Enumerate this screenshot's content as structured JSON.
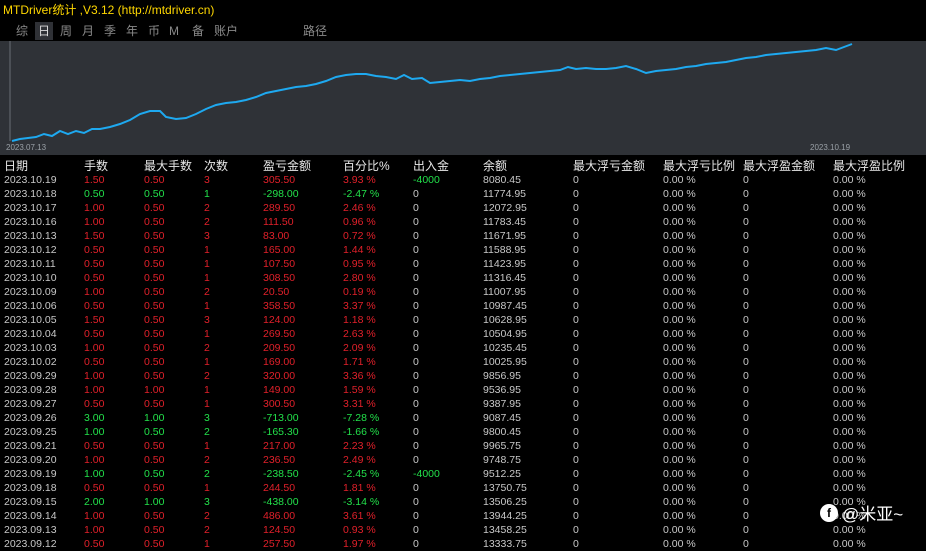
{
  "window": {
    "title": "MTDriver统计 ,V3.12 (http://mtdriver.cn)"
  },
  "tabs": [
    {
      "label": "综",
      "active": false
    },
    {
      "label": "日",
      "active": true
    },
    {
      "label": "周",
      "active": false
    },
    {
      "label": "月",
      "active": false
    },
    {
      "label": "季",
      "active": false
    },
    {
      "label": "年",
      "active": false
    },
    {
      "label": "币",
      "active": false
    },
    {
      "label": "M",
      "active": false
    },
    {
      "label": "备",
      "active": false
    },
    {
      "label": "账户",
      "active": false
    },
    {
      "label": "路径",
      "active": false
    }
  ],
  "chart": {
    "start_date": "2023.07.13",
    "end_date": "2023.10.19",
    "line_color": "#1ea9f0"
  },
  "headers": [
    "日期",
    "手数",
    "最大手数",
    "次数",
    "盈亏金额",
    "百分比%",
    "出入金",
    "余额",
    "最大浮亏金额",
    "最大浮亏比例",
    "最大浮盈金额",
    "最大浮盈比例"
  ],
  "rows": [
    {
      "date": "2023.10.19",
      "lots": "1.50",
      "max_lots": "0.50",
      "count": "3",
      "pnl": "305.50",
      "pct": "3.93 %",
      "flow": "-4000",
      "balance": "8080.45",
      "maxdd": "0",
      "maxdd_pct": "0.00 %",
      "maxfu": "0",
      "maxfu_pct": "0.00 %",
      "color": "red",
      "flow_color": "green"
    },
    {
      "date": "2023.10.18",
      "lots": "0.50",
      "max_lots": "0.50",
      "count": "1",
      "pnl": "-298.00",
      "pct": "-2.47 %",
      "flow": "0",
      "balance": "11774.95",
      "maxdd": "0",
      "maxdd_pct": "0.00 %",
      "maxfu": "0",
      "maxfu_pct": "0.00 %",
      "color": "green",
      "flow_color": "gray"
    },
    {
      "date": "2023.10.17",
      "lots": "1.00",
      "max_lots": "0.50",
      "count": "2",
      "pnl": "289.50",
      "pct": "2.46 %",
      "flow": "0",
      "balance": "12072.95",
      "maxdd": "0",
      "maxdd_pct": "0.00 %",
      "maxfu": "0",
      "maxfu_pct": "0.00 %",
      "color": "red",
      "flow_color": "gray"
    },
    {
      "date": "2023.10.16",
      "lots": "1.00",
      "max_lots": "0.50",
      "count": "2",
      "pnl": "111.50",
      "pct": "0.96 %",
      "flow": "0",
      "balance": "11783.45",
      "maxdd": "0",
      "maxdd_pct": "0.00 %",
      "maxfu": "0",
      "maxfu_pct": "0.00 %",
      "color": "red",
      "flow_color": "gray"
    },
    {
      "date": "2023.10.13",
      "lots": "1.50",
      "max_lots": "0.50",
      "count": "3",
      "pnl": "83.00",
      "pct": "0.72 %",
      "flow": "0",
      "balance": "11671.95",
      "maxdd": "0",
      "maxdd_pct": "0.00 %",
      "maxfu": "0",
      "maxfu_pct": "0.00 %",
      "color": "red",
      "flow_color": "gray"
    },
    {
      "date": "2023.10.12",
      "lots": "0.50",
      "max_lots": "0.50",
      "count": "1",
      "pnl": "165.00",
      "pct": "1.44 %",
      "flow": "0",
      "balance": "11588.95",
      "maxdd": "0",
      "maxdd_pct": "0.00 %",
      "maxfu": "0",
      "maxfu_pct": "0.00 %",
      "color": "red",
      "flow_color": "gray"
    },
    {
      "date": "2023.10.11",
      "lots": "0.50",
      "max_lots": "0.50",
      "count": "1",
      "pnl": "107.50",
      "pct": "0.95 %",
      "flow": "0",
      "balance": "11423.95",
      "maxdd": "0",
      "maxdd_pct": "0.00 %",
      "maxfu": "0",
      "maxfu_pct": "0.00 %",
      "color": "red",
      "flow_color": "gray"
    },
    {
      "date": "2023.10.10",
      "lots": "0.50",
      "max_lots": "0.50",
      "count": "1",
      "pnl": "308.50",
      "pct": "2.80 %",
      "flow": "0",
      "balance": "11316.45",
      "maxdd": "0",
      "maxdd_pct": "0.00 %",
      "maxfu": "0",
      "maxfu_pct": "0.00 %",
      "color": "red",
      "flow_color": "gray"
    },
    {
      "date": "2023.10.09",
      "lots": "1.00",
      "max_lots": "0.50",
      "count": "2",
      "pnl": "20.50",
      "pct": "0.19 %",
      "flow": "0",
      "balance": "11007.95",
      "maxdd": "0",
      "maxdd_pct": "0.00 %",
      "maxfu": "0",
      "maxfu_pct": "0.00 %",
      "color": "red",
      "flow_color": "gray"
    },
    {
      "date": "2023.10.06",
      "lots": "0.50",
      "max_lots": "0.50",
      "count": "1",
      "pnl": "358.50",
      "pct": "3.37 %",
      "flow": "0",
      "balance": "10987.45",
      "maxdd": "0",
      "maxdd_pct": "0.00 %",
      "maxfu": "0",
      "maxfu_pct": "0.00 %",
      "color": "red",
      "flow_color": "gray"
    },
    {
      "date": "2023.10.05",
      "lots": "1.50",
      "max_lots": "0.50",
      "count": "3",
      "pnl": "124.00",
      "pct": "1.18 %",
      "flow": "0",
      "balance": "10628.95",
      "maxdd": "0",
      "maxdd_pct": "0.00 %",
      "maxfu": "0",
      "maxfu_pct": "0.00 %",
      "color": "red",
      "flow_color": "gray"
    },
    {
      "date": "2023.10.04",
      "lots": "0.50",
      "max_lots": "0.50",
      "count": "1",
      "pnl": "269.50",
      "pct": "2.63 %",
      "flow": "0",
      "balance": "10504.95",
      "maxdd": "0",
      "maxdd_pct": "0.00 %",
      "maxfu": "0",
      "maxfu_pct": "0.00 %",
      "color": "red",
      "flow_color": "gray"
    },
    {
      "date": "2023.10.03",
      "lots": "1.00",
      "max_lots": "0.50",
      "count": "2",
      "pnl": "209.50",
      "pct": "2.09 %",
      "flow": "0",
      "balance": "10235.45",
      "maxdd": "0",
      "maxdd_pct": "0.00 %",
      "maxfu": "0",
      "maxfu_pct": "0.00 %",
      "color": "red",
      "flow_color": "gray"
    },
    {
      "date": "2023.10.02",
      "lots": "0.50",
      "max_lots": "0.50",
      "count": "1",
      "pnl": "169.00",
      "pct": "1.71 %",
      "flow": "0",
      "balance": "10025.95",
      "maxdd": "0",
      "maxdd_pct": "0.00 %",
      "maxfu": "0",
      "maxfu_pct": "0.00 %",
      "color": "red",
      "flow_color": "gray"
    },
    {
      "date": "2023.09.29",
      "lots": "1.00",
      "max_lots": "0.50",
      "count": "2",
      "pnl": "320.00",
      "pct": "3.36 %",
      "flow": "0",
      "balance": "9856.95",
      "maxdd": "0",
      "maxdd_pct": "0.00 %",
      "maxfu": "0",
      "maxfu_pct": "0.00 %",
      "color": "red",
      "flow_color": "gray"
    },
    {
      "date": "2023.09.28",
      "lots": "1.00",
      "max_lots": "1.00",
      "count": "1",
      "pnl": "149.00",
      "pct": "1.59 %",
      "flow": "0",
      "balance": "9536.95",
      "maxdd": "0",
      "maxdd_pct": "0.00 %",
      "maxfu": "0",
      "maxfu_pct": "0.00 %",
      "color": "red",
      "flow_color": "gray"
    },
    {
      "date": "2023.09.27",
      "lots": "0.50",
      "max_lots": "0.50",
      "count": "1",
      "pnl": "300.50",
      "pct": "3.31 %",
      "flow": "0",
      "balance": "9387.95",
      "maxdd": "0",
      "maxdd_pct": "0.00 %",
      "maxfu": "0",
      "maxfu_pct": "0.00 %",
      "color": "red",
      "flow_color": "gray"
    },
    {
      "date": "2023.09.26",
      "lots": "3.00",
      "max_lots": "1.00",
      "count": "3",
      "pnl": "-713.00",
      "pct": "-7.28 %",
      "flow": "0",
      "balance": "9087.45",
      "maxdd": "0",
      "maxdd_pct": "0.00 %",
      "maxfu": "0",
      "maxfu_pct": "0.00 %",
      "color": "green",
      "flow_color": "gray"
    },
    {
      "date": "2023.09.25",
      "lots": "1.00",
      "max_lots": "0.50",
      "count": "2",
      "pnl": "-165.30",
      "pct": "-1.66 %",
      "flow": "0",
      "balance": "9800.45",
      "maxdd": "0",
      "maxdd_pct": "0.00 %",
      "maxfu": "0",
      "maxfu_pct": "0.00 %",
      "color": "green",
      "flow_color": "gray"
    },
    {
      "date": "2023.09.21",
      "lots": "0.50",
      "max_lots": "0.50",
      "count": "1",
      "pnl": "217.00",
      "pct": "2.23 %",
      "flow": "0",
      "balance": "9965.75",
      "maxdd": "0",
      "maxdd_pct": "0.00 %",
      "maxfu": "0",
      "maxfu_pct": "0.00 %",
      "color": "red",
      "flow_color": "gray"
    },
    {
      "date": "2023.09.20",
      "lots": "1.00",
      "max_lots": "0.50",
      "count": "2",
      "pnl": "236.50",
      "pct": "2.49 %",
      "flow": "0",
      "balance": "9748.75",
      "maxdd": "0",
      "maxdd_pct": "0.00 %",
      "maxfu": "0",
      "maxfu_pct": "0.00 %",
      "color": "red",
      "flow_color": "gray"
    },
    {
      "date": "2023.09.19",
      "lots": "1.00",
      "max_lots": "0.50",
      "count": "2",
      "pnl": "-238.50",
      "pct": "-2.45 %",
      "flow": "-4000",
      "balance": "9512.25",
      "maxdd": "0",
      "maxdd_pct": "0.00 %",
      "maxfu": "0",
      "maxfu_pct": "0.00 %",
      "color": "green",
      "flow_color": "green"
    },
    {
      "date": "2023.09.18",
      "lots": "0.50",
      "max_lots": "0.50",
      "count": "1",
      "pnl": "244.50",
      "pct": "1.81 %",
      "flow": "0",
      "balance": "13750.75",
      "maxdd": "0",
      "maxdd_pct": "0.00 %",
      "maxfu": "0",
      "maxfu_pct": "0.00 %",
      "color": "red",
      "flow_color": "gray"
    },
    {
      "date": "2023.09.15",
      "lots": "2.00",
      "max_lots": "1.00",
      "count": "3",
      "pnl": "-438.00",
      "pct": "-3.14 %",
      "flow": "0",
      "balance": "13506.25",
      "maxdd": "0",
      "maxdd_pct": "0.00 %",
      "maxfu": "0",
      "maxfu_pct": "0.00 %",
      "color": "green",
      "flow_color": "gray"
    },
    {
      "date": "2023.09.14",
      "lots": "1.00",
      "max_lots": "0.50",
      "count": "2",
      "pnl": "486.00",
      "pct": "3.61 %",
      "flow": "0",
      "balance": "13944.25",
      "maxdd": "0",
      "maxdd_pct": "0.00 %",
      "maxfu": "0",
      "maxfu_pct": "0.00 %",
      "color": "red",
      "flow_color": "gray"
    },
    {
      "date": "2023.09.13",
      "lots": "1.00",
      "max_lots": "0.50",
      "count": "2",
      "pnl": "124.50",
      "pct": "0.93 %",
      "flow": "0",
      "balance": "13458.25",
      "maxdd": "0",
      "maxdd_pct": "0.00 %",
      "maxfu": "0",
      "maxfu_pct": "0.00 %",
      "color": "red",
      "flow_color": "gray"
    },
    {
      "date": "2023.09.12",
      "lots": "0.50",
      "max_lots": "0.50",
      "count": "1",
      "pnl": "257.50",
      "pct": "1.97 %",
      "flow": "0",
      "balance": "13333.75",
      "maxdd": "0",
      "maxdd_pct": "0.00 %",
      "maxfu": "0",
      "maxfu_pct": "0.00 %",
      "color": "red",
      "flow_color": "gray"
    }
  ],
  "watermark": {
    "icon": "facebook-icon",
    "text": "@米亚~"
  }
}
